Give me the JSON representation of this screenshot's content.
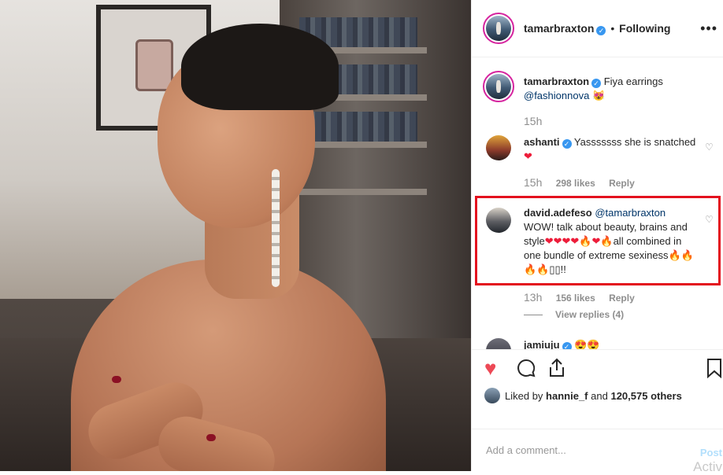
{
  "header": {
    "username": "tamarbraxton",
    "separator": "•",
    "follow_status": "Following",
    "more_icon": "more-options-icon"
  },
  "caption": {
    "username": "tamarbraxton",
    "text": "Fiya earrings",
    "mention": "@fashionnova",
    "emoji": "😻",
    "time": "15h"
  },
  "comments": [
    {
      "username": "ashanti",
      "verified": true,
      "text": "Yasssssss she is snatched",
      "emoji": "❤",
      "time": "15h",
      "likes": "298 likes",
      "reply_label": "Reply"
    },
    {
      "username": "david.adefeso",
      "mention": "@tamarbraxton",
      "text_part1": "WOW! talk about beauty, brains and style",
      "emojis_1": "❤❤❤❤🔥❤🔥",
      "text_part2": "all combined in one bundle of extreme sexiness",
      "emojis_2": "🔥🔥🔥🔥",
      "tail": "▯▯!!",
      "time": "13h",
      "likes": "156 likes",
      "reply_label": "Reply",
      "view_replies": "View replies (4)"
    },
    {
      "username": "jamiuju",
      "emoji": "😍😍"
    }
  ],
  "actions": {
    "like_icon": "heart-filled-icon",
    "comment_icon": "comment-icon",
    "share_icon": "share-icon",
    "save_icon": "bookmark-icon",
    "liked_prefix": "Liked by",
    "liked_user": "hannie_f",
    "liked_connector": "and",
    "liked_count": "120,575 others"
  },
  "add_comment": {
    "placeholder": "Add a comment...",
    "post_label": "Post",
    "overlay_text": "Activ"
  },
  "colors": {
    "accent_blue": "#3897f0",
    "like_red": "#ed4956",
    "highlight_red": "#e3111e",
    "muted": "#8e8e8e"
  }
}
